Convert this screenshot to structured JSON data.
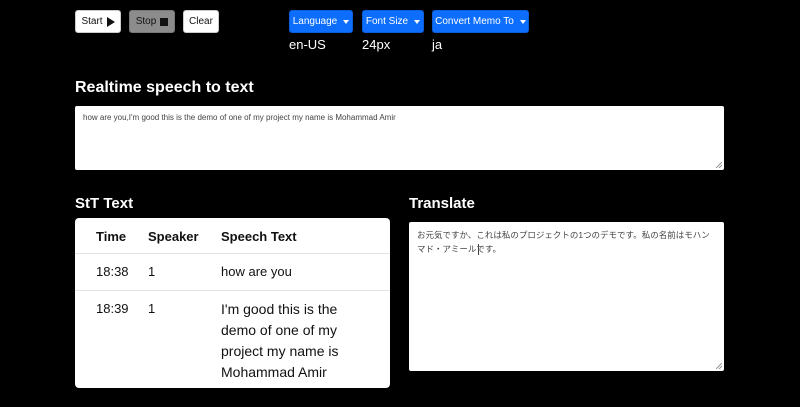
{
  "toolbar": {
    "start_label": "Start",
    "stop_label": "Stop",
    "clear_label": "Clear"
  },
  "settings": {
    "language": {
      "label": "Language",
      "value": "en-US"
    },
    "font_size": {
      "label": "Font Size",
      "value": "24px"
    },
    "convert": {
      "label": "Convert Memo To",
      "value": "ja"
    }
  },
  "realtime": {
    "heading": "Realtime speech to text",
    "text": "how are you,I'm good this is the demo of one of my project my name is Mohammad Amir"
  },
  "stt": {
    "heading": "StT Text",
    "columns": [
      "Time",
      "Speaker",
      "Speech Text"
    ],
    "rows": [
      {
        "time": "18:38",
        "speaker": "1",
        "text": "how are you"
      },
      {
        "time": "18:39",
        "speaker": "1",
        "text": "I'm good this is the demo of one of my project my name is Mohammad Amir"
      }
    ]
  },
  "translate": {
    "heading": "Translate",
    "text": "お元気ですか、これは私のプロジェクトの1つのデモです。私の名前はモハンマド・アミールです。"
  },
  "colors": {
    "primary": "#0d6efd",
    "stop_button": "#8c8c8c",
    "background": "#000000"
  }
}
